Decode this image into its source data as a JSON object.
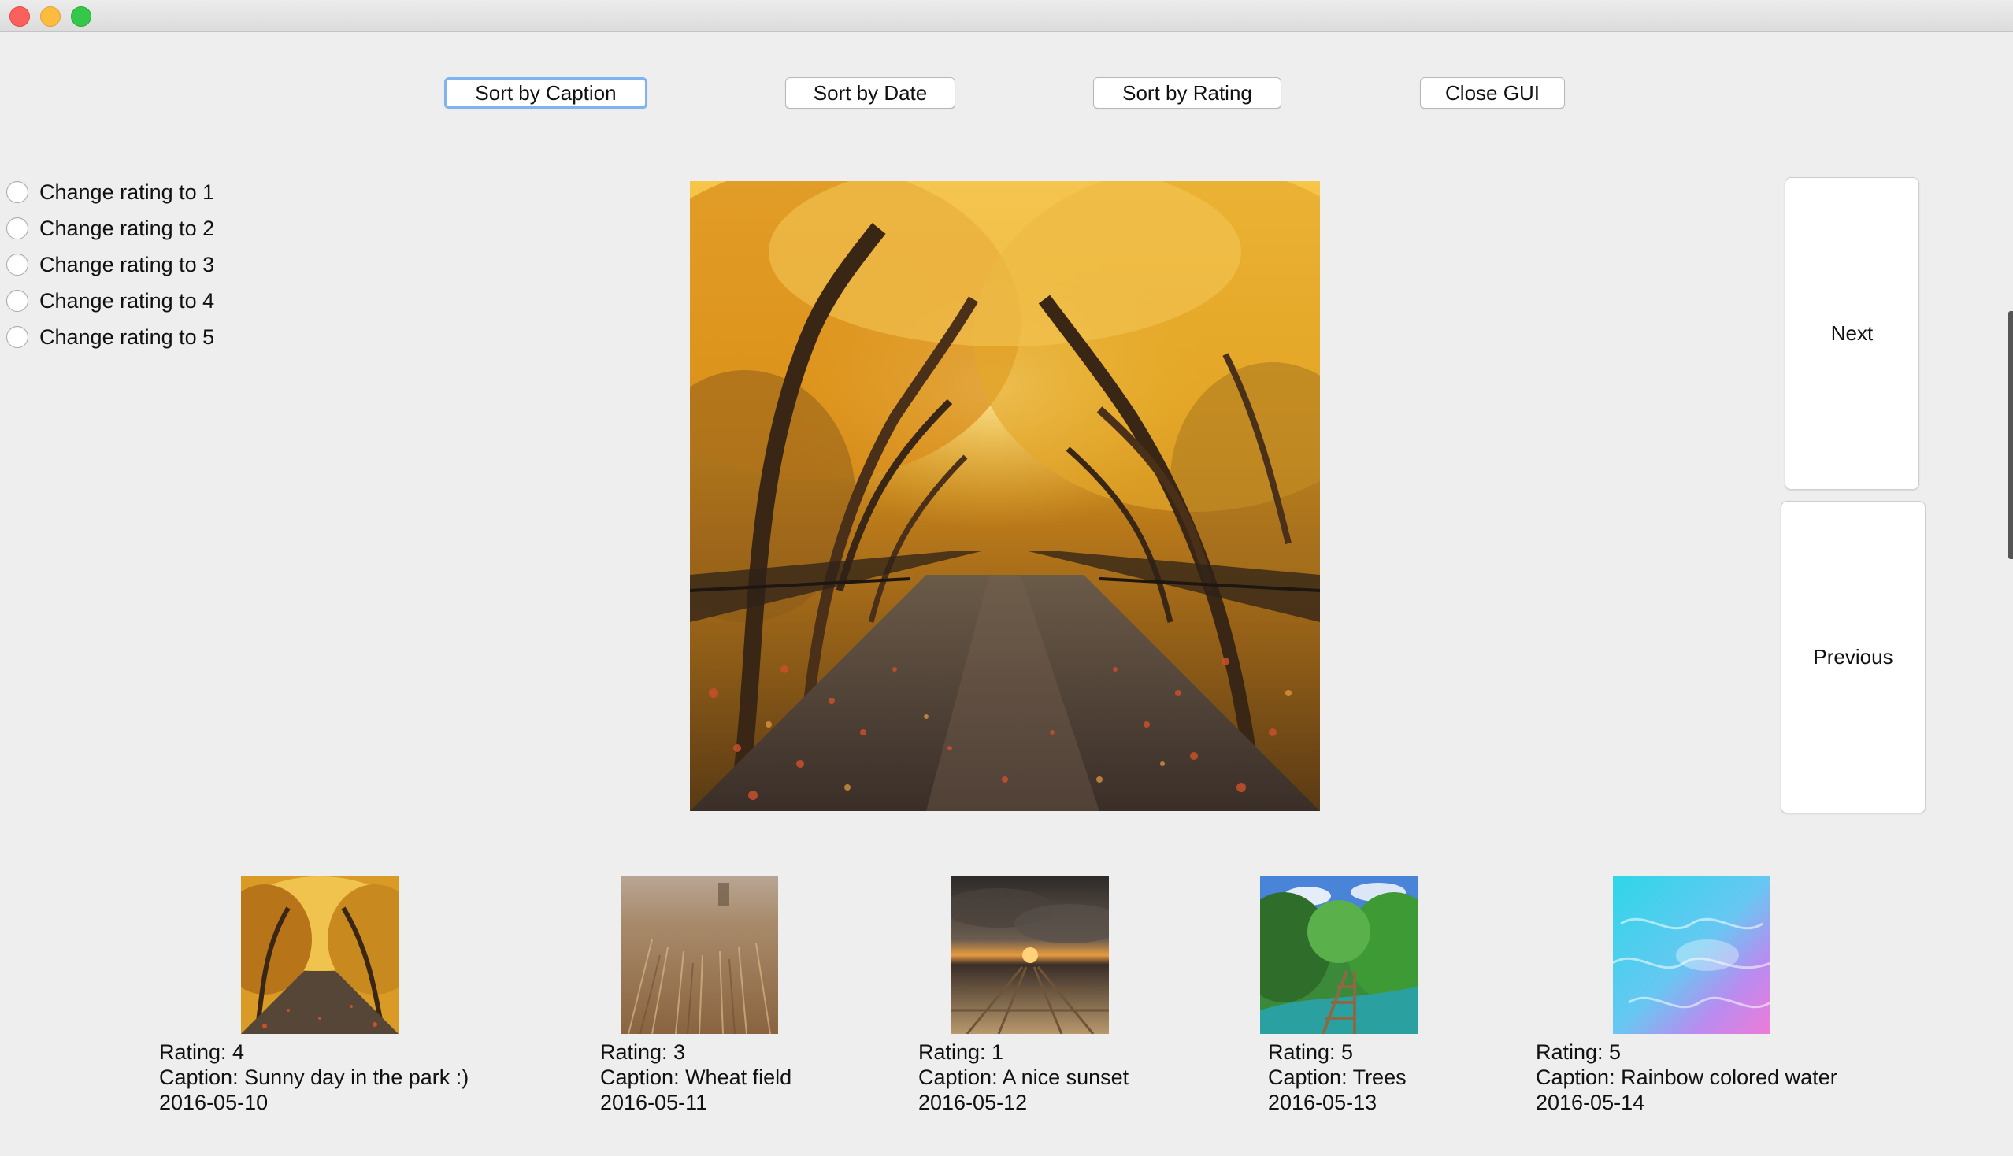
{
  "toolbar": {
    "sort_caption": "Sort by Caption",
    "sort_date": "Sort by Date",
    "sort_rating": "Sort by Rating",
    "close_gui": "Close GUI"
  },
  "rating_options": [
    {
      "label": "Change rating to 1"
    },
    {
      "label": "Change rating to 2"
    },
    {
      "label": "Change rating to 3"
    },
    {
      "label": "Change rating to 4"
    },
    {
      "label": "Change rating to 5"
    }
  ],
  "nav": {
    "next": "Next",
    "previous": "Previous"
  },
  "thumbnails": [
    {
      "rating": "Rating: 4",
      "caption": "Caption: Sunny day in the park :)",
      "date": "2016-05-10"
    },
    {
      "rating": "Rating: 3",
      "caption": "Caption: Wheat field",
      "date": "2016-05-11"
    },
    {
      "rating": "Rating: 1",
      "caption": "Caption: A nice sunset",
      "date": "2016-05-12"
    },
    {
      "rating": "Rating: 5",
      "caption": "Caption: Trees",
      "date": "2016-05-13"
    },
    {
      "rating": "Rating: 5",
      "caption": "Caption: Rainbow colored water",
      "date": "2016-05-14"
    }
  ],
  "colors": {
    "focus_ring": "#7fb4f0",
    "window_bg": "#eeeeee"
  }
}
